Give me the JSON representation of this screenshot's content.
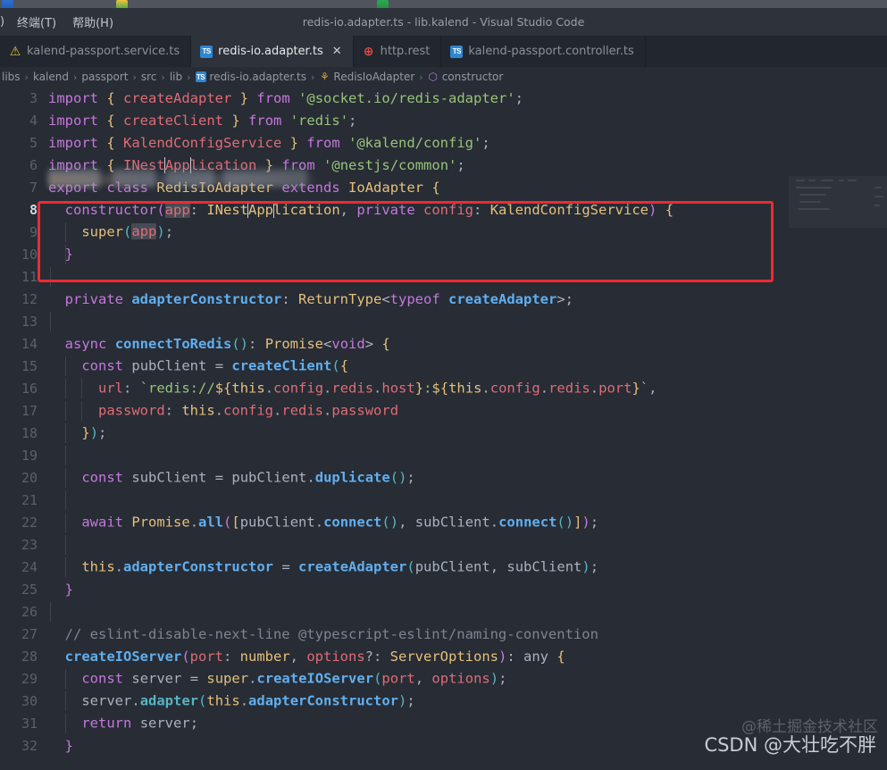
{
  "window": {
    "title": "redis-io.adapter.ts - lib.kalend - Visual Studio Code"
  },
  "menubar": {
    "clipped_item": ")",
    "items": [
      {
        "label": "终端(T)",
        "name": "menu-terminal"
      },
      {
        "label": "帮助(H)",
        "name": "menu-help"
      }
    ]
  },
  "tabs": [
    {
      "label": "kalend-passport.service.ts",
      "icon": "warning-icon",
      "icon_glyph": "⚠",
      "active": false,
      "closable": false
    },
    {
      "label": "redis-io.adapter.ts",
      "icon": "typescript-file-icon",
      "icon_glyph": "TS",
      "active": true,
      "closable": true,
      "close_glyph": "✕"
    },
    {
      "label": "http.rest",
      "icon": "globe-icon",
      "icon_glyph": "⊕",
      "active": false,
      "closable": false
    },
    {
      "label": "kalend-passport.controller.ts",
      "icon": "typescript-file-icon",
      "icon_glyph": "TS",
      "active": false,
      "closable": false
    }
  ],
  "breadcrumb": {
    "separator": "›",
    "items": [
      {
        "label": "libs",
        "icon": null
      },
      {
        "label": "kalend",
        "icon": null
      },
      {
        "label": "passport",
        "icon": null
      },
      {
        "label": "src",
        "icon": null
      },
      {
        "label": "lib",
        "icon": null
      },
      {
        "label": "redis-io.adapter.ts",
        "icon": "typescript-file-icon",
        "icon_glyph": "TS"
      },
      {
        "label": "RedisIoAdapter",
        "icon": "class-symbol-icon",
        "icon_glyph": "⚘"
      },
      {
        "label": "constructor",
        "icon": "method-symbol-icon",
        "icon_glyph": "⬡"
      }
    ]
  },
  "editor": {
    "first_visible_line": 3,
    "current_line": 8,
    "language": "TypeScript",
    "redacted_line_present": true,
    "lines": [
      {
        "n": 3,
        "text": "import { createAdapter } from '@socket.io/redis-adapter';"
      },
      {
        "n": 4,
        "text": "import { createClient } from 'redis';"
      },
      {
        "n": 5,
        "text": "import { KalendConfigService } from '@kalend/config';"
      },
      {
        "n": 6,
        "text": "import { INestApplication } from '@nestjs/common';"
      },
      {
        "n": 7,
        "text": "export class RedisIoAdapter extends IoAdapter {"
      },
      {
        "n": 8,
        "text": "  constructor(app: INestApplication, private config: KalendConfigService) {"
      },
      {
        "n": 9,
        "text": "    super(app);"
      },
      {
        "n": 10,
        "text": "  }"
      },
      {
        "n": 11,
        "text": ""
      },
      {
        "n": 12,
        "text": "  private adapterConstructor: ReturnType<typeof createAdapter>;"
      },
      {
        "n": 13,
        "text": ""
      },
      {
        "n": 14,
        "text": "  async connectToRedis(): Promise<void> {"
      },
      {
        "n": 15,
        "text": "    const pubClient = createClient({"
      },
      {
        "n": 16,
        "text": "      url: `redis://${this.config.redis.host}:${this.config.redis.port}`,"
      },
      {
        "n": 17,
        "text": "      password: this.config.redis.password"
      },
      {
        "n": 18,
        "text": "    });"
      },
      {
        "n": 19,
        "text": ""
      },
      {
        "n": 20,
        "text": "    const subClient = pubClient.duplicate();"
      },
      {
        "n": 21,
        "text": ""
      },
      {
        "n": 22,
        "text": "    await Promise.all([pubClient.connect(), subClient.connect()]);"
      },
      {
        "n": 23,
        "text": ""
      },
      {
        "n": 24,
        "text": "    this.adapterConstructor = createAdapter(pubClient, subClient);"
      },
      {
        "n": 25,
        "text": "  }"
      },
      {
        "n": 26,
        "text": ""
      },
      {
        "n": 27,
        "text": "  // eslint-disable-next-line @typescript-eslint/naming-convention"
      },
      {
        "n": 28,
        "text": "  createIOServer(port: number, options?: ServerOptions): any {"
      },
      {
        "n": 29,
        "text": "    const server = super.createIOServer(port, options);"
      },
      {
        "n": 30,
        "text": "    server.adapter(this.adapterConstructor);"
      },
      {
        "n": 31,
        "text": "    return server;"
      },
      {
        "n": 32,
        "text": "  }"
      }
    ],
    "highlighted_words": [
      "app",
      "app",
      "App"
    ]
  },
  "annotation": {
    "color": "#ee2a30",
    "covers_lines": [
      8,
      9,
      10
    ],
    "shape": "rectangle"
  },
  "watermarks": [
    {
      "text": "@稀土掘金技术社区",
      "name": "juejin-watermark"
    },
    {
      "text": "CSDN @大壮吃不胖",
      "name": "csdn-watermark"
    }
  ],
  "theme": {
    "editor_background": "#272c35",
    "tabbar_background": "#22262e",
    "active_tab_background": "#2d323b",
    "titlebar_background": "#2d323b",
    "line_number_color": "#5a616c",
    "active_line_number_color": "#d4d8de",
    "keyword_color": "#c678dd",
    "function_color": "#61afef",
    "type_color": "#e5c07b",
    "string_color": "#98c379",
    "variable_color": "#e06c75",
    "comment_color": "#7f848e"
  }
}
